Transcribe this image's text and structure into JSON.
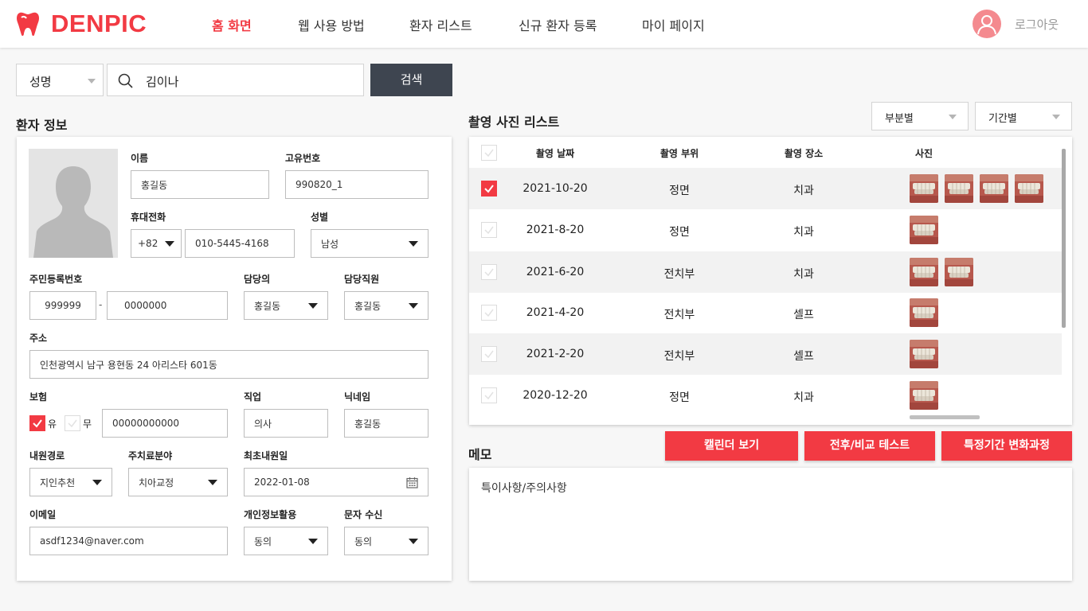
{
  "brand": {
    "name": "DENPIC",
    "accent_color": "#f23a43",
    "dark_button_color": "#3e4550"
  },
  "nav": {
    "items": [
      "홈 화면",
      "웹 사용 방법",
      "환자 리스트",
      "신규 환자 등록",
      "마이 페이지"
    ],
    "active_index": 0,
    "logout_label": "로그아웃",
    "avatar_icon": "user-avatar-icon"
  },
  "search": {
    "type_selected": "성명",
    "query": "김이나",
    "button_label": "검색"
  },
  "patient": {
    "section_title": "환자 정보",
    "name_label": "이름",
    "name": "홍길동",
    "id_label": "고유번호",
    "id": "990820_1",
    "phone_label": "휴대전화",
    "phone_country": "+82",
    "phone": "010-5445-4168",
    "gender_label": "성별",
    "gender": "남성",
    "rrn_label": "주민등록번호",
    "rrn_front": "999999",
    "rrn_sep": "-",
    "rrn_back": "0000000",
    "doctor_label": "담당의",
    "doctor": "홍길동",
    "staff_label": "담당직원",
    "staff": "홍길동",
    "address_label": "주소",
    "address": "인천광역시 남구 용현동 24 아리스타 601동",
    "insurance_label": "보험",
    "insurance_yes": "유",
    "insurance_no": "무",
    "insurance_yes_checked": true,
    "insurance_number": "00000000000",
    "job_label": "직업",
    "job": "의사",
    "nickname_label": "닉네임",
    "nickname": "홍길동",
    "route_label": "내원경로",
    "route": "지인추천",
    "treatment_label": "주치료분야",
    "treatment": "치아교정",
    "first_visit_label": "최초내원일",
    "first_visit": "2022-01-08",
    "email_label": "이메일",
    "email": "asdf1234@naver.com",
    "privacy_label": "개인정보활용",
    "privacy": "동의",
    "sms_label": "문자 수신",
    "sms": "동의"
  },
  "photos": {
    "section_title": "촬영 사진 리스트",
    "filter_part": "부분별",
    "filter_period": "기간별",
    "columns": [
      "촬영 날짜",
      "촬영 부위",
      "촬영 장소",
      "사진"
    ],
    "rows": [
      {
        "date": "2021-10-20",
        "part": "정면",
        "place": "치과",
        "thumbs": 4,
        "checked": true
      },
      {
        "date": "2021-8-20",
        "part": "정면",
        "place": "치과",
        "thumbs": 1,
        "checked": false
      },
      {
        "date": "2021-6-20",
        "part": "전치부",
        "place": "치과",
        "thumbs": 2,
        "checked": false
      },
      {
        "date": "2021-4-20",
        "part": "전치부",
        "place": "셀프",
        "thumbs": 1,
        "checked": false
      },
      {
        "date": "2021-2-20",
        "part": "전치부",
        "place": "셀프",
        "thumbs": 1,
        "checked": false
      },
      {
        "date": "2020-12-20",
        "part": "정면",
        "place": "치과",
        "thumbs": 1,
        "checked": false
      }
    ]
  },
  "actions": {
    "calendar": "캘린더 보기",
    "compare": "전후/비교 테스트",
    "period_change": "특정기간 변화과정"
  },
  "memo": {
    "title": "메모",
    "text": "특이사항/주의사항"
  }
}
